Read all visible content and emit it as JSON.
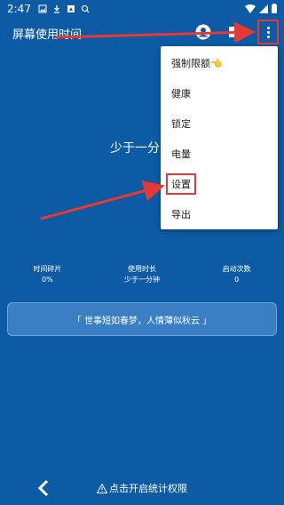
{
  "status": {
    "time": "2:47"
  },
  "appbar": {
    "title": "屏幕使用时间"
  },
  "usage": {
    "summary": "少于一分"
  },
  "stats": [
    {
      "label": "时间碎片",
      "value": "0%"
    },
    {
      "label": "使用时长",
      "value": "少于一分钟"
    },
    {
      "label": "启动次数",
      "value": "0"
    }
  ],
  "quote": "「 世事短如春梦，人情薄似秋云 」",
  "menu": {
    "items": [
      {
        "label": "强制限额👈"
      },
      {
        "label": "健康"
      },
      {
        "label": "锁定"
      },
      {
        "label": "电量"
      },
      {
        "label": "设置"
      },
      {
        "label": "导出"
      }
    ]
  },
  "bottom": {
    "permission_text": "点击开启统计权限"
  },
  "colors": {
    "background": "#0d5ba4",
    "annotation": "#e53935",
    "menu_bg": "#ffffff"
  }
}
